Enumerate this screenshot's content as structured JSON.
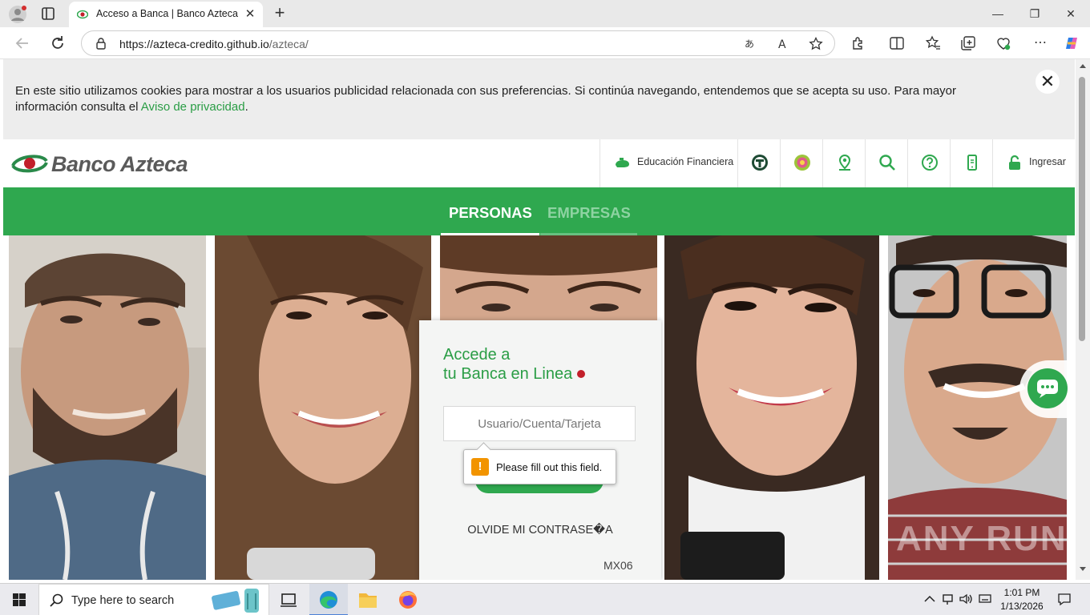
{
  "browser": {
    "tab_title": "Acceso a Banca | Banco Azteca",
    "url_host": "https://azteca-credito.github.io",
    "url_path": "/azteca/"
  },
  "cookie_banner": {
    "text": "En este sitio utilizamos cookies para mostrar a los usuarios publicidad relacionada con sus preferencias. Si continúa navegando, entendemos que se acepta su uso. Para mayor información consulta el",
    "link": "Aviso de privacidad",
    "end": "."
  },
  "header": {
    "logo_text": "Banco Azteca",
    "nav_educacion": "Educación Financiera",
    "nav_ingresar": "Ingresar"
  },
  "segments": {
    "personas": "PERSONAS",
    "empresas": "EMPRESAS"
  },
  "login": {
    "title_line1": "Accede a",
    "title_line2": "tu Banca en Linea",
    "user_placeholder": "Usuario/Cuenta/Tarjeta",
    "forgot": "OLVIDE MI CONTRASE�A",
    "version": "MX06"
  },
  "validation": {
    "message": "Please fill out this field."
  },
  "watermark": "ANY RUN",
  "taskbar": {
    "search_placeholder": "Type here to search",
    "time": "1:01 PM",
    "date": "1/13/2026"
  },
  "colors": {
    "brand_green": "#2fa84f",
    "brand_red": "#c21f2a",
    "link_green": "#2a9d45"
  }
}
